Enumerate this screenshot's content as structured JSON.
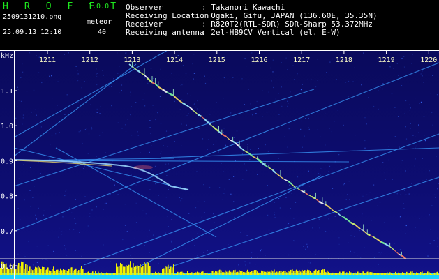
{
  "header": {
    "app_name": "H R O F F T",
    "app_version": "1.0.0",
    "file_name": "2509131210.png",
    "meteor_label": "meteor",
    "date_time": "25.09.13 12:10",
    "meteor_count": "40",
    "info": [
      {
        "key": "Observer",
        "value": ": Takanori Kawachi"
      },
      {
        "key": "Receiving Location",
        "value": ": Ogaki, Gifu, JAPAN (136.60E, 35.35N)"
      },
      {
        "key": "Receiver",
        "value": ": R820T2(RTL-SDR) SDR-Sharp 53.372MHz"
      },
      {
        "key": "Receiving antenna",
        "value": ": 2el-HB9CV Vertical (el. E-W)"
      }
    ]
  },
  "spectrogram": {
    "y_unit": "kHz",
    "time_ticks": [
      "1211",
      "1212",
      "1213",
      "1214",
      "1215",
      "1216",
      "1217",
      "1218",
      "1219",
      "1220"
    ],
    "freq_ticks": [
      "1.1",
      "1.0",
      "0.9",
      "0.8",
      "0.7",
      "0.6"
    ],
    "colors": {
      "background": "#0d0d6b",
      "axis": "#ffffff",
      "trace": "#3a9cff",
      "tick_label": "#ffffff",
      "time_label": "#ffffc8",
      "level_bars": "#f2f200",
      "level_base": "#1ad4ff"
    }
  }
}
